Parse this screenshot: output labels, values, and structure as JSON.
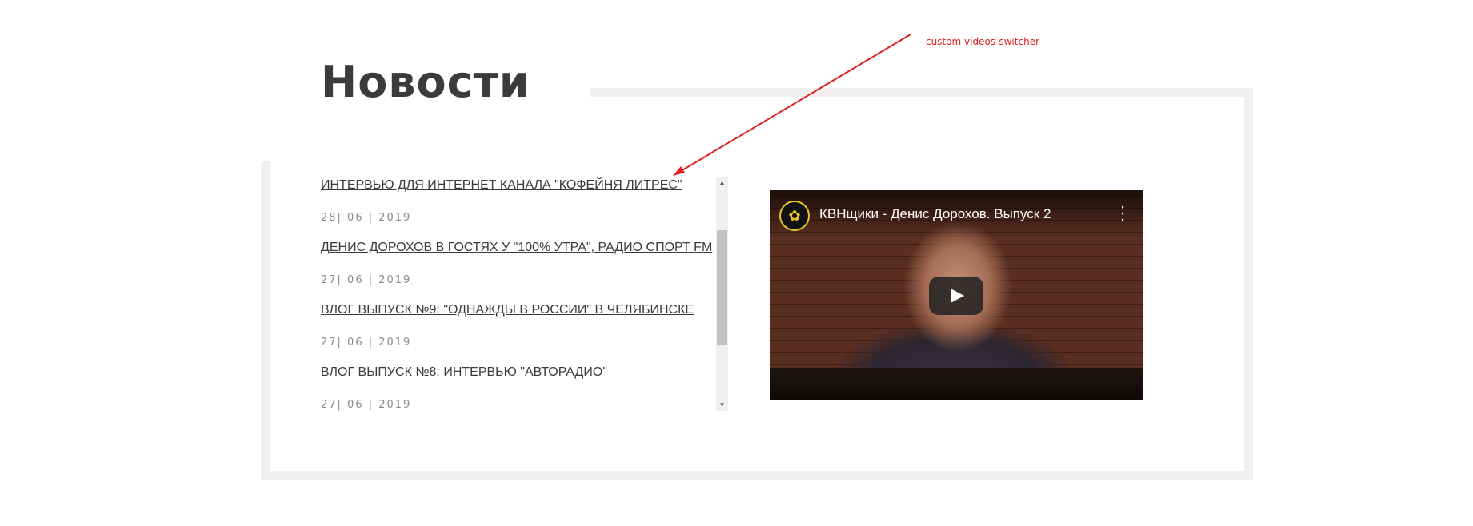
{
  "page": {
    "title": "Новости"
  },
  "news": [
    {
      "title": "ИНТЕРВЬЮ ДЛЯ ИНТЕРНЕТ КАНАЛА \"КОФЕЙНЯ ЛИТРЕС\"",
      "date": "28| 06 | 2019"
    },
    {
      "title": "ДЕНИС ДОРОХОВ В ГОСТЯХ У \"100% УТРА\", РАДИО СПОРТ FM",
      "date": "27| 06 | 2019"
    },
    {
      "title": "ВЛОГ ВЫПУСК №9: \"ОДНАЖДЫ В РОССИИ\" В ЧЕЛЯБИНСКЕ",
      "date": "27| 06 | 2019"
    },
    {
      "title": "ВЛОГ ВЫПУСК №8: ИНТЕРВЬЮ \"АВТОРАДИО\"",
      "date": "27| 06 | 2019"
    }
  ],
  "video": {
    "title": "КВНщики - Денис Дорохов. Выпуск 2",
    "channel_icon": "kvn-channel-logo",
    "menu_icon": "more-vertical-icon",
    "play_icon": "play-icon"
  },
  "annotation": {
    "text": "custom videos-switcher",
    "color": "#e02020"
  },
  "colors": {
    "heading": "#3a3b3d",
    "date": "#8b8b8b",
    "frame": "#f1f0ee"
  }
}
